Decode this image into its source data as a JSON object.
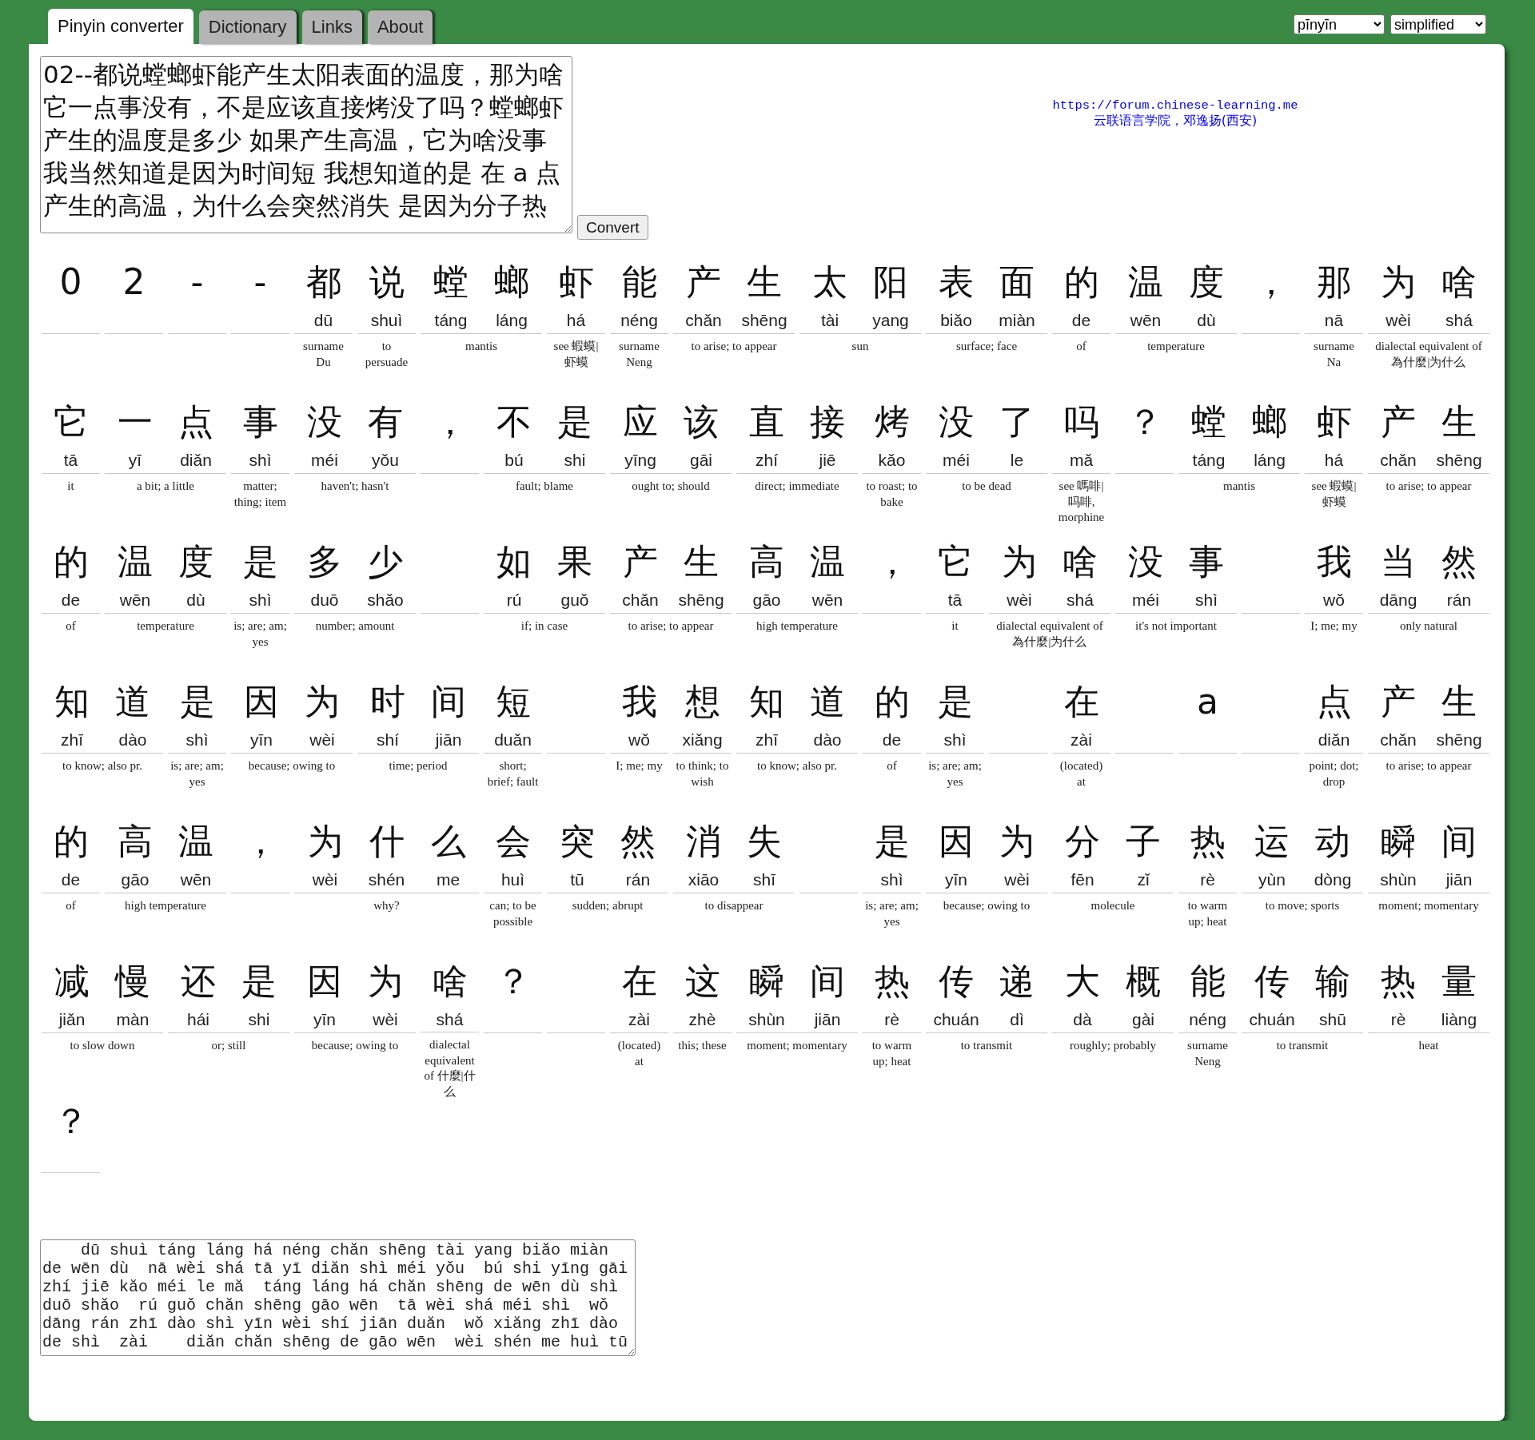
{
  "tabs": [
    {
      "label": "Pinyin converter",
      "selected": true
    },
    {
      "label": "Dictionary",
      "selected": false
    },
    {
      "label": "Links",
      "selected": false
    },
    {
      "label": "About",
      "selected": false
    }
  ],
  "selects": {
    "romanization": "pīnyīn",
    "charset": "simplified"
  },
  "input": {
    "lines": [
      "02--都说螳螂虾能产生太阳表面的温度，那为啥",
      "它一点事没有，不是应该直接烤没了吗？螳螂虾",
      "产生的温度是多少 如果产生高温，它为啥没事",
      "我当然知道是因为时间短 我想知道的是 在 a 点",
      "产生的高温，为什么会突然消失 是因为分子热"
    ],
    "button": "Convert"
  },
  "credit": {
    "link": "https://forum.chinese-learning.me",
    "text": "云联语言学院，邓逸扬(西安)"
  },
  "rows": [
    [
      {
        "kind": "word",
        "chars": [
          {
            "hanzi": "0"
          }
        ]
      },
      {
        "kind": "word",
        "chars": [
          {
            "hanzi": "2"
          }
        ]
      },
      {
        "kind": "word",
        "chars": [
          {
            "hanzi": "-"
          }
        ]
      },
      {
        "kind": "word",
        "chars": [
          {
            "hanzi": "-"
          }
        ]
      },
      {
        "kind": "word",
        "chars": [
          {
            "hanzi": "都",
            "pinyin": "dū"
          }
        ],
        "gloss": "surname Du"
      },
      {
        "kind": "word",
        "chars": [
          {
            "hanzi": "说",
            "pinyin": "shuì"
          }
        ],
        "gloss": "to persuade"
      },
      {
        "kind": "word",
        "chars": [
          {
            "hanzi": "螳",
            "pinyin": "táng"
          },
          {
            "hanzi": "螂",
            "pinyin": "láng"
          }
        ],
        "gloss": "mantis"
      },
      {
        "kind": "word",
        "chars": [
          {
            "hanzi": "虾",
            "pinyin": "há"
          }
        ],
        "gloss": "see 蝦蟆|虾蟆"
      },
      {
        "kind": "word",
        "chars": [
          {
            "hanzi": "能",
            "pinyin": "néng"
          }
        ],
        "gloss": "surname Neng"
      },
      {
        "kind": "word",
        "chars": [
          {
            "hanzi": "产",
            "pinyin": "chǎn"
          },
          {
            "hanzi": "生",
            "pinyin": "shēng"
          }
        ],
        "gloss": "to arise; to appear"
      },
      {
        "kind": "word",
        "chars": [
          {
            "hanzi": "太",
            "pinyin": "tài"
          },
          {
            "hanzi": "阳",
            "pinyin": "yang"
          }
        ],
        "gloss": "sun"
      },
      {
        "kind": "word",
        "chars": [
          {
            "hanzi": "表",
            "pinyin": "biǎo"
          },
          {
            "hanzi": "面",
            "pinyin": "miàn"
          }
        ],
        "gloss": "surface; face"
      },
      {
        "kind": "word",
        "chars": [
          {
            "hanzi": "的",
            "pinyin": "de"
          }
        ],
        "gloss": "of"
      },
      {
        "kind": "word",
        "chars": [
          {
            "hanzi": "温",
            "pinyin": "wēn"
          },
          {
            "hanzi": "度",
            "pinyin": "dù"
          }
        ],
        "gloss": "temperature"
      },
      {
        "kind": "word",
        "chars": [
          {
            "hanzi": "，"
          }
        ]
      },
      {
        "kind": "word",
        "chars": [
          {
            "hanzi": "那",
            "pinyin": "nā"
          }
        ],
        "gloss": "surname Na"
      },
      {
        "kind": "word",
        "chars": [
          {
            "hanzi": "为",
            "pinyin": "wèi"
          },
          {
            "hanzi": "啥",
            "pinyin": "shá"
          }
        ],
        "gloss": "dialectal equivalent of 為什麼|为什么"
      }
    ],
    [
      {
        "kind": "word",
        "chars": [
          {
            "hanzi": "它",
            "pinyin": "tā"
          }
        ],
        "gloss": "it"
      },
      {
        "kind": "word",
        "chars": [
          {
            "hanzi": "一",
            "pinyin": "yī"
          },
          {
            "hanzi": "点",
            "pinyin": "diǎn"
          }
        ],
        "gloss": "a bit; a little"
      },
      {
        "kind": "word",
        "chars": [
          {
            "hanzi": "事",
            "pinyin": "shì"
          }
        ],
        "gloss": "matter; thing; item"
      },
      {
        "kind": "word",
        "chars": [
          {
            "hanzi": "没",
            "pinyin": "méi"
          },
          {
            "hanzi": "有",
            "pinyin": "yǒu"
          }
        ],
        "gloss": "haven't; hasn't"
      },
      {
        "kind": "word",
        "chars": [
          {
            "hanzi": "，"
          }
        ]
      },
      {
        "kind": "word",
        "chars": [
          {
            "hanzi": "不",
            "pinyin": "bú"
          },
          {
            "hanzi": "是",
            "pinyin": "shi"
          }
        ],
        "gloss": "fault; blame"
      },
      {
        "kind": "word",
        "chars": [
          {
            "hanzi": "应",
            "pinyin": "yīng"
          },
          {
            "hanzi": "该",
            "pinyin": "gāi"
          }
        ],
        "gloss": "ought to; should"
      },
      {
        "kind": "word",
        "chars": [
          {
            "hanzi": "直",
            "pinyin": "zhí"
          },
          {
            "hanzi": "接",
            "pinyin": "jiē"
          }
        ],
        "gloss": "direct; immediate"
      },
      {
        "kind": "word",
        "chars": [
          {
            "hanzi": "烤",
            "pinyin": "kǎo"
          }
        ],
        "gloss": "to roast; to bake"
      },
      {
        "kind": "word",
        "chars": [
          {
            "hanzi": "没",
            "pinyin": "méi"
          },
          {
            "hanzi": "了",
            "pinyin": "le"
          }
        ],
        "gloss": "to be dead"
      },
      {
        "kind": "word",
        "chars": [
          {
            "hanzi": "吗",
            "pinyin": "mǎ"
          }
        ],
        "gloss": "see 嗎啡|吗啡, morphine"
      },
      {
        "kind": "word",
        "chars": [
          {
            "hanzi": "？"
          }
        ]
      },
      {
        "kind": "word",
        "chars": [
          {
            "hanzi": "螳",
            "pinyin": "táng"
          },
          {
            "hanzi": "螂",
            "pinyin": "láng"
          }
        ],
        "gloss": "mantis"
      },
      {
        "kind": "word",
        "chars": [
          {
            "hanzi": "虾",
            "pinyin": "há"
          }
        ],
        "gloss": "see 蝦蟆|虾蟆"
      },
      {
        "kind": "word",
        "chars": [
          {
            "hanzi": "产",
            "pinyin": "chǎn"
          },
          {
            "hanzi": "生",
            "pinyin": "shēng"
          }
        ],
        "gloss": "to arise; to appear"
      }
    ],
    [
      {
        "kind": "word",
        "chars": [
          {
            "hanzi": "的",
            "pinyin": "de"
          }
        ],
        "gloss": "of"
      },
      {
        "kind": "word",
        "chars": [
          {
            "hanzi": "温",
            "pinyin": "wēn"
          },
          {
            "hanzi": "度",
            "pinyin": "dù"
          }
        ],
        "gloss": "temperature"
      },
      {
        "kind": "word",
        "chars": [
          {
            "hanzi": "是",
            "pinyin": "shì"
          }
        ],
        "gloss": "is; are; am; yes"
      },
      {
        "kind": "word",
        "chars": [
          {
            "hanzi": "多",
            "pinyin": "duō"
          },
          {
            "hanzi": "少",
            "pinyin": "shǎo"
          }
        ],
        "gloss": "number; amount"
      },
      {
        "kind": "space"
      },
      {
        "kind": "word",
        "chars": [
          {
            "hanzi": "如",
            "pinyin": "rú"
          },
          {
            "hanzi": "果",
            "pinyin": "guǒ"
          }
        ],
        "gloss": "if; in case"
      },
      {
        "kind": "word",
        "chars": [
          {
            "hanzi": "产",
            "pinyin": "chǎn"
          },
          {
            "hanzi": "生",
            "pinyin": "shēng"
          }
        ],
        "gloss": "to arise; to appear"
      },
      {
        "kind": "word",
        "chars": [
          {
            "hanzi": "高",
            "pinyin": "gāo"
          },
          {
            "hanzi": "温",
            "pinyin": "wēn"
          }
        ],
        "gloss": "high temperature"
      },
      {
        "kind": "word",
        "chars": [
          {
            "hanzi": "，"
          }
        ]
      },
      {
        "kind": "word",
        "chars": [
          {
            "hanzi": "它",
            "pinyin": "tā"
          }
        ],
        "gloss": "it"
      },
      {
        "kind": "word",
        "chars": [
          {
            "hanzi": "为",
            "pinyin": "wèi"
          },
          {
            "hanzi": "啥",
            "pinyin": "shá"
          }
        ],
        "gloss": "dialectal equivalent of 為什麼|为什么"
      },
      {
        "kind": "word",
        "chars": [
          {
            "hanzi": "没",
            "pinyin": "méi"
          },
          {
            "hanzi": "事",
            "pinyin": "shì"
          }
        ],
        "gloss": "it's not important"
      },
      {
        "kind": "space"
      },
      {
        "kind": "word",
        "chars": [
          {
            "hanzi": "我",
            "pinyin": "wǒ"
          }
        ],
        "gloss": "I; me; my"
      },
      {
        "kind": "word",
        "chars": [
          {
            "hanzi": "当",
            "pinyin": "dāng"
          },
          {
            "hanzi": "然",
            "pinyin": "rán"
          }
        ],
        "gloss": "only natural"
      }
    ],
    [
      {
        "kind": "word",
        "chars": [
          {
            "hanzi": "知",
            "pinyin": "zhī"
          },
          {
            "hanzi": "道",
            "pinyin": "dào"
          }
        ],
        "gloss": "to know; also pr."
      },
      {
        "kind": "word",
        "chars": [
          {
            "hanzi": "是",
            "pinyin": "shì"
          }
        ],
        "gloss": "is; are; am; yes"
      },
      {
        "kind": "word",
        "chars": [
          {
            "hanzi": "因",
            "pinyin": "yīn"
          },
          {
            "hanzi": "为",
            "pinyin": "wèi"
          }
        ],
        "gloss": "because; owing to"
      },
      {
        "kind": "word",
        "chars": [
          {
            "hanzi": "时",
            "pinyin": "shí"
          },
          {
            "hanzi": "间",
            "pinyin": "jiān"
          }
        ],
        "gloss": "time; period"
      },
      {
        "kind": "word",
        "chars": [
          {
            "hanzi": "短",
            "pinyin": "duǎn"
          }
        ],
        "gloss": "short; brief; fault"
      },
      {
        "kind": "space"
      },
      {
        "kind": "word",
        "chars": [
          {
            "hanzi": "我",
            "pinyin": "wǒ"
          }
        ],
        "gloss": "I; me; my"
      },
      {
        "kind": "word",
        "chars": [
          {
            "hanzi": "想",
            "pinyin": "xiǎng"
          }
        ],
        "gloss": "to think; to wish"
      },
      {
        "kind": "word",
        "chars": [
          {
            "hanzi": "知",
            "pinyin": "zhī"
          },
          {
            "hanzi": "道",
            "pinyin": "dào"
          }
        ],
        "gloss": "to know; also pr."
      },
      {
        "kind": "word",
        "chars": [
          {
            "hanzi": "的",
            "pinyin": "de"
          }
        ],
        "gloss": "of"
      },
      {
        "kind": "word",
        "chars": [
          {
            "hanzi": "是",
            "pinyin": "shì"
          }
        ],
        "gloss": "is; are; am; yes"
      },
      {
        "kind": "space"
      },
      {
        "kind": "word",
        "chars": [
          {
            "hanzi": "在",
            "pinyin": "zài"
          }
        ],
        "gloss": "(located) at"
      },
      {
        "kind": "space"
      },
      {
        "kind": "word",
        "chars": [
          {
            "hanzi": "a"
          }
        ]
      },
      {
        "kind": "space"
      },
      {
        "kind": "word",
        "chars": [
          {
            "hanzi": "点",
            "pinyin": "diǎn"
          }
        ],
        "gloss": "point; dot; drop"
      },
      {
        "kind": "word",
        "chars": [
          {
            "hanzi": "产",
            "pinyin": "chǎn"
          },
          {
            "hanzi": "生",
            "pinyin": "shēng"
          }
        ],
        "gloss": "to arise; to appear"
      }
    ],
    [
      {
        "kind": "word",
        "chars": [
          {
            "hanzi": "的",
            "pinyin": "de"
          }
        ],
        "gloss": "of"
      },
      {
        "kind": "word",
        "chars": [
          {
            "hanzi": "高",
            "pinyin": "gāo"
          },
          {
            "hanzi": "温",
            "pinyin": "wēn"
          }
        ],
        "gloss": "high temperature"
      },
      {
        "kind": "word",
        "chars": [
          {
            "hanzi": "，"
          }
        ]
      },
      {
        "kind": "word",
        "chars": [
          {
            "hanzi": "为",
            "pinyin": "wèi"
          },
          {
            "hanzi": "什",
            "pinyin": "shén"
          },
          {
            "hanzi": "么",
            "pinyin": "me"
          }
        ],
        "gloss": "why?"
      },
      {
        "kind": "word",
        "chars": [
          {
            "hanzi": "会",
            "pinyin": "huì"
          }
        ],
        "gloss": "can; to be possible"
      },
      {
        "kind": "word",
        "chars": [
          {
            "hanzi": "突",
            "pinyin": "tū"
          },
          {
            "hanzi": "然",
            "pinyin": "rán"
          }
        ],
        "gloss": "sudden; abrupt"
      },
      {
        "kind": "word",
        "chars": [
          {
            "hanzi": "消",
            "pinyin": "xiāo"
          },
          {
            "hanzi": "失",
            "pinyin": "shī"
          }
        ],
        "gloss": "to disappear"
      },
      {
        "kind": "space"
      },
      {
        "kind": "word",
        "chars": [
          {
            "hanzi": "是",
            "pinyin": "shì"
          }
        ],
        "gloss": "is; are; am; yes"
      },
      {
        "kind": "word",
        "chars": [
          {
            "hanzi": "因",
            "pinyin": "yīn"
          },
          {
            "hanzi": "为",
            "pinyin": "wèi"
          }
        ],
        "gloss": "because; owing to"
      },
      {
        "kind": "word",
        "chars": [
          {
            "hanzi": "分",
            "pinyin": "fēn"
          },
          {
            "hanzi": "子",
            "pinyin": "zǐ"
          }
        ],
        "gloss": "molecule"
      },
      {
        "kind": "word",
        "chars": [
          {
            "hanzi": "热",
            "pinyin": "rè"
          }
        ],
        "gloss": "to warm up; heat"
      },
      {
        "kind": "word",
        "chars": [
          {
            "hanzi": "运",
            "pinyin": "yùn"
          },
          {
            "hanzi": "动",
            "pinyin": "dòng"
          }
        ],
        "gloss": "to move; sports"
      },
      {
        "kind": "word",
        "chars": [
          {
            "hanzi": "瞬",
            "pinyin": "shùn"
          },
          {
            "hanzi": "间",
            "pinyin": "jiān"
          }
        ],
        "gloss": "moment; momentary"
      }
    ],
    [
      {
        "kind": "word",
        "chars": [
          {
            "hanzi": "减",
            "pinyin": "jiǎn"
          },
          {
            "hanzi": "慢",
            "pinyin": "màn"
          }
        ],
        "gloss": "to slow down"
      },
      {
        "kind": "word",
        "chars": [
          {
            "hanzi": "还",
            "pinyin": "hái"
          },
          {
            "hanzi": "是",
            "pinyin": "shi"
          }
        ],
        "gloss": "or; still"
      },
      {
        "kind": "word",
        "chars": [
          {
            "hanzi": "因",
            "pinyin": "yīn"
          },
          {
            "hanzi": "为",
            "pinyin": "wèi"
          }
        ],
        "gloss": "because; owing to"
      },
      {
        "kind": "word",
        "chars": [
          {
            "hanzi": "啥",
            "pinyin": "shá"
          }
        ],
        "gloss": "dialectal equivalent of 什麼|什么"
      },
      {
        "kind": "word",
        "chars": [
          {
            "hanzi": "？"
          }
        ]
      },
      {
        "kind": "space"
      },
      {
        "kind": "word",
        "chars": [
          {
            "hanzi": "在",
            "pinyin": "zài"
          }
        ],
        "gloss": "(located) at"
      },
      {
        "kind": "word",
        "chars": [
          {
            "hanzi": "这",
            "pinyin": "zhè"
          }
        ],
        "gloss": "this; these"
      },
      {
        "kind": "word",
        "chars": [
          {
            "hanzi": "瞬",
            "pinyin": "shùn"
          },
          {
            "hanzi": "间",
            "pinyin": "jiān"
          }
        ],
        "gloss": "moment; momentary"
      },
      {
        "kind": "word",
        "chars": [
          {
            "hanzi": "热",
            "pinyin": "rè"
          }
        ],
        "gloss": "to warm up; heat"
      },
      {
        "kind": "word",
        "chars": [
          {
            "hanzi": "传",
            "pinyin": "chuán"
          },
          {
            "hanzi": "递",
            "pinyin": "dì"
          }
        ],
        "gloss": "to transmit"
      },
      {
        "kind": "word",
        "chars": [
          {
            "hanzi": "大",
            "pinyin": "dà"
          },
          {
            "hanzi": "概",
            "pinyin": "gài"
          }
        ],
        "gloss": "roughly; probably"
      },
      {
        "kind": "word",
        "chars": [
          {
            "hanzi": "能",
            "pinyin": "néng"
          }
        ],
        "gloss": "surname Neng"
      },
      {
        "kind": "word",
        "chars": [
          {
            "hanzi": "传",
            "pinyin": "chuán"
          },
          {
            "hanzi": "输",
            "pinyin": "shū"
          }
        ],
        "gloss": "to transmit"
      },
      {
        "kind": "word",
        "chars": [
          {
            "hanzi": "热",
            "pinyin": "rè"
          },
          {
            "hanzi": "量",
            "pinyin": "liàng"
          }
        ],
        "gloss": "heat"
      }
    ],
    [
      {
        "kind": "word",
        "chars": [
          {
            "hanzi": "？"
          }
        ]
      }
    ]
  ],
  "pinyin_output": {
    "lines": [
      "    dū shuì táng láng há néng chăn shēng tài yang biăo miàn",
      "de wēn dù  nā wèi shá tā yī diăn shì méi yǒu  bú shi yīng gāi",
      "zhí jiē kăo méi le mă  táng láng há chăn shēng de wēn dù shì",
      "duō shăo  rú guǒ chăn shēng gāo wēn  tā wèi shá méi shì  wǒ",
      "dāng rán zhī dào shì yīn wèi shí jiān duăn  wǒ xiăng zhī dào",
      "de shì  zài    diăn chăn shēng de gāo wēn  wèi shén me huì tū"
    ]
  }
}
